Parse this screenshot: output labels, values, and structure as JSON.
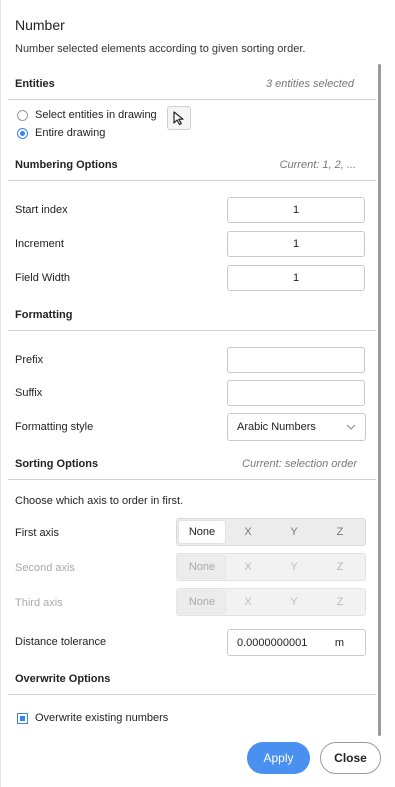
{
  "dialog": {
    "title": "Number",
    "description": "Number selected elements according to given sorting order."
  },
  "entities": {
    "title": "Entities",
    "status": "3 entities selected",
    "options": [
      {
        "label": "Select entities in drawing",
        "selected": false
      },
      {
        "label": "Entire drawing",
        "selected": true
      }
    ],
    "pick_icon": "cursor-select-icon"
  },
  "numbering": {
    "title": "Numbering Options",
    "current": "Current: 1, 2, ...",
    "start_index": {
      "label": "Start index",
      "value": "1"
    },
    "increment": {
      "label": "Increment",
      "value": "1"
    },
    "field_width": {
      "label": "Field Width",
      "value": "1"
    }
  },
  "formatting": {
    "title": "Formatting",
    "prefix": {
      "label": "Prefix",
      "value": ""
    },
    "suffix": {
      "label": "Suffix",
      "value": ""
    },
    "style": {
      "label": "Formatting style",
      "value": "Arabic Numbers",
      "icon": "chevron-down-icon"
    }
  },
  "sorting": {
    "title": "Sorting Options",
    "current": "Current: selection order",
    "instruction": "Choose which axis to order in first.",
    "axis_options": [
      "None",
      "X",
      "Y",
      "Z"
    ],
    "first_axis": {
      "label": "First axis",
      "selected": "None",
      "enabled": true
    },
    "second_axis": {
      "label": "Second axis",
      "selected": "None",
      "enabled": false
    },
    "third_axis": {
      "label": "Third axis",
      "selected": "None",
      "enabled": false
    },
    "tolerance": {
      "label": "Distance tolerance",
      "value": "0.0000000001",
      "unit": "m"
    }
  },
  "overwrite": {
    "title": "Overwrite Options",
    "checkbox_label": "Overwrite existing numbers",
    "checked": true
  },
  "footer": {
    "apply_label": "Apply",
    "close_label": "Close"
  },
  "colors": {
    "accent": "#4a90f0",
    "radio_accent": "#3b82f6"
  }
}
